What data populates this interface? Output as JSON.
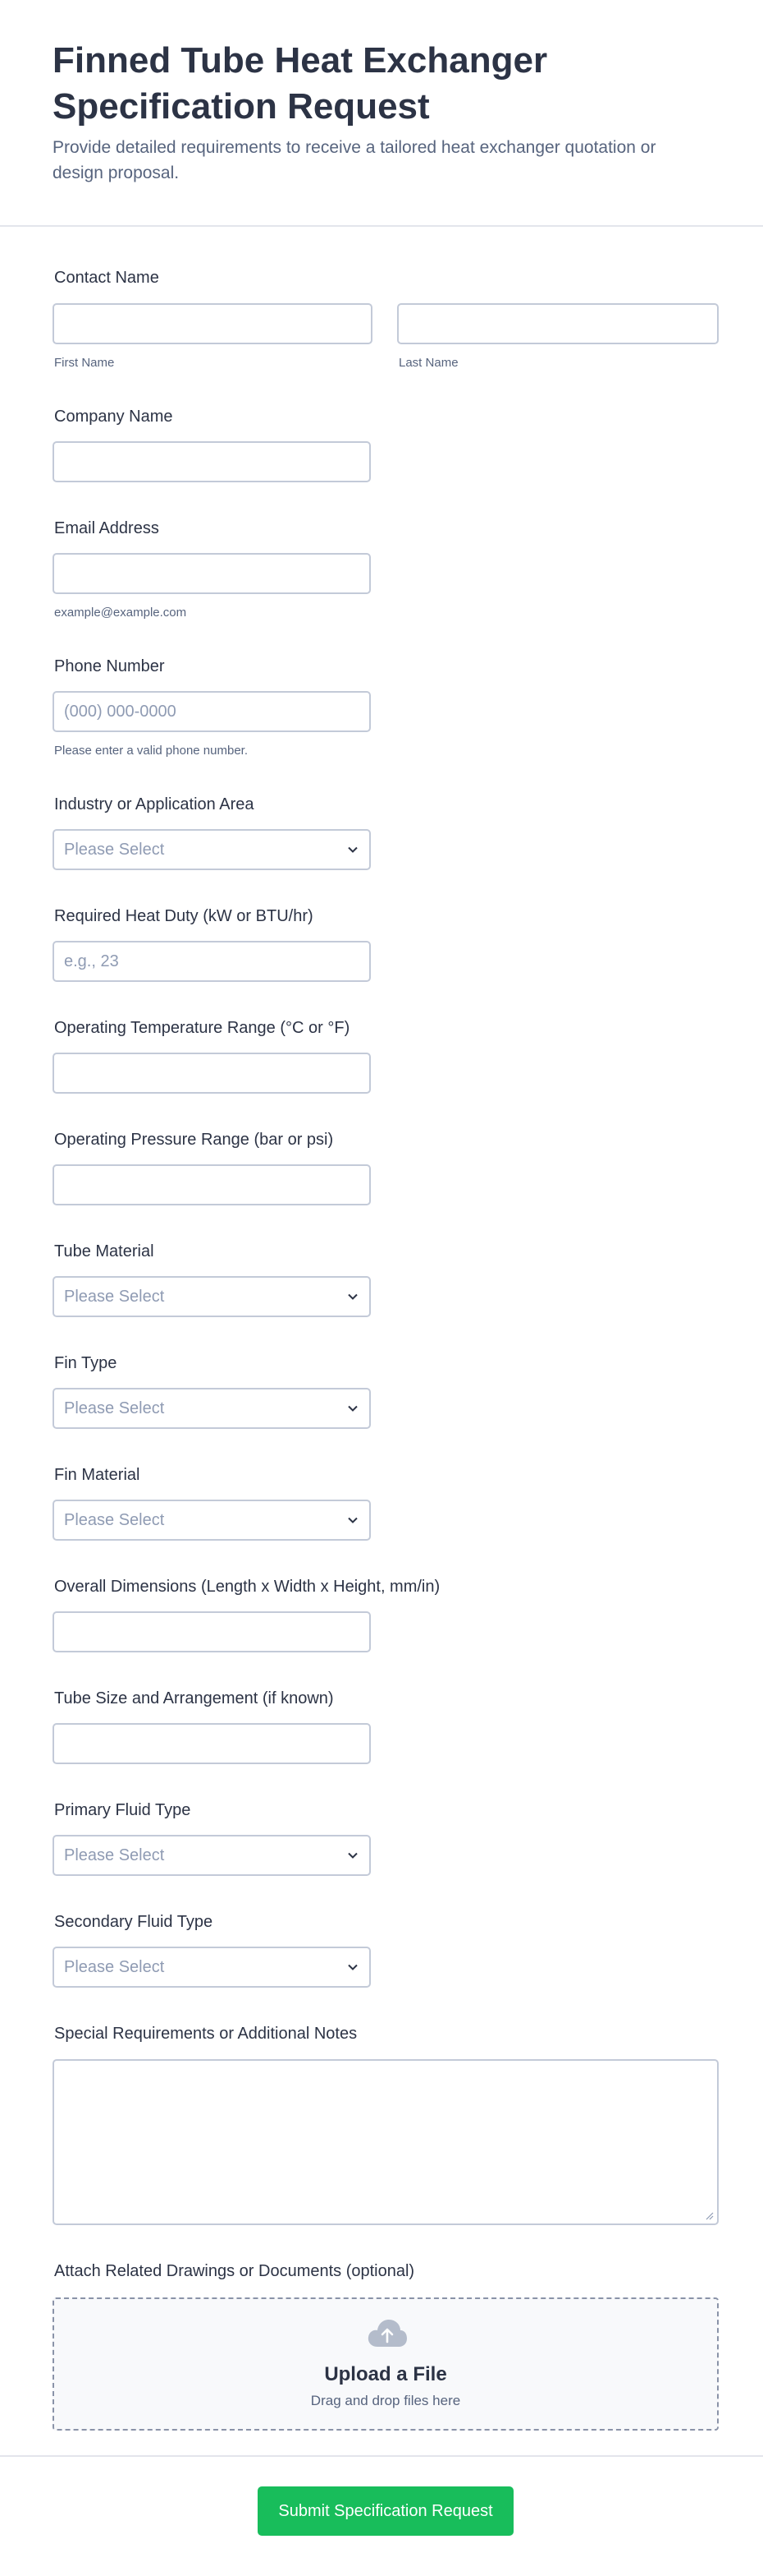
{
  "form": {
    "title": "Finned Tube Heat Exchanger Specification Request",
    "subtitle": "Provide detailed requirements to receive a tailored heat exchanger quotation or design proposal."
  },
  "contact": {
    "label": "Contact Name",
    "first_sublabel": "First Name",
    "last_sublabel": "Last Name",
    "first_value": "",
    "last_value": ""
  },
  "company": {
    "label": "Company Name",
    "value": ""
  },
  "email": {
    "label": "Email Address",
    "value": "",
    "sublabel": "example@example.com"
  },
  "phone": {
    "label": "Phone Number",
    "placeholder": "(000) 000-0000",
    "sublabel": "Please enter a valid phone number."
  },
  "industry": {
    "label": "Industry or Application Area",
    "selected": "Please Select"
  },
  "heat_duty": {
    "label": "Required Heat Duty (kW or BTU/hr)",
    "placeholder": "e.g., 23"
  },
  "temperature": {
    "label": "Operating Temperature Range (°C or °F)",
    "value": ""
  },
  "pressure": {
    "label": "Operating Pressure Range (bar or psi)",
    "value": ""
  },
  "tube_material": {
    "label": "Tube Material",
    "selected": "Please Select"
  },
  "fin_type": {
    "label": "Fin Type",
    "selected": "Please Select"
  },
  "fin_material": {
    "label": "Fin Material",
    "selected": "Please Select"
  },
  "dimensions": {
    "label": "Overall Dimensions (Length x Width x Height, mm/in)",
    "value": ""
  },
  "tube_size": {
    "label": "Tube Size and Arrangement (if known)",
    "value": ""
  },
  "primary_fluid": {
    "label": "Primary Fluid Type",
    "selected": "Please Select"
  },
  "secondary_fluid": {
    "label": "Secondary Fluid Type",
    "selected": "Please Select"
  },
  "notes": {
    "label": "Special Requirements or Additional Notes",
    "value": ""
  },
  "attachments": {
    "label": "Attach Related Drawings or Documents (optional)",
    "upload_title": "Upload a File",
    "upload_hint": "Drag and drop files here"
  },
  "submit": {
    "label": "Submit Specification Request"
  },
  "colors": {
    "accent": "#18bd5b",
    "text": "#2c3345",
    "muted": "#57647e",
    "border": "#c3cad8",
    "placeholder": "#8f9bb3"
  },
  "icons": {
    "select_arrow": "chevron-down-icon",
    "upload": "cloud-upload-icon",
    "resize": "resize-handle-icon"
  }
}
